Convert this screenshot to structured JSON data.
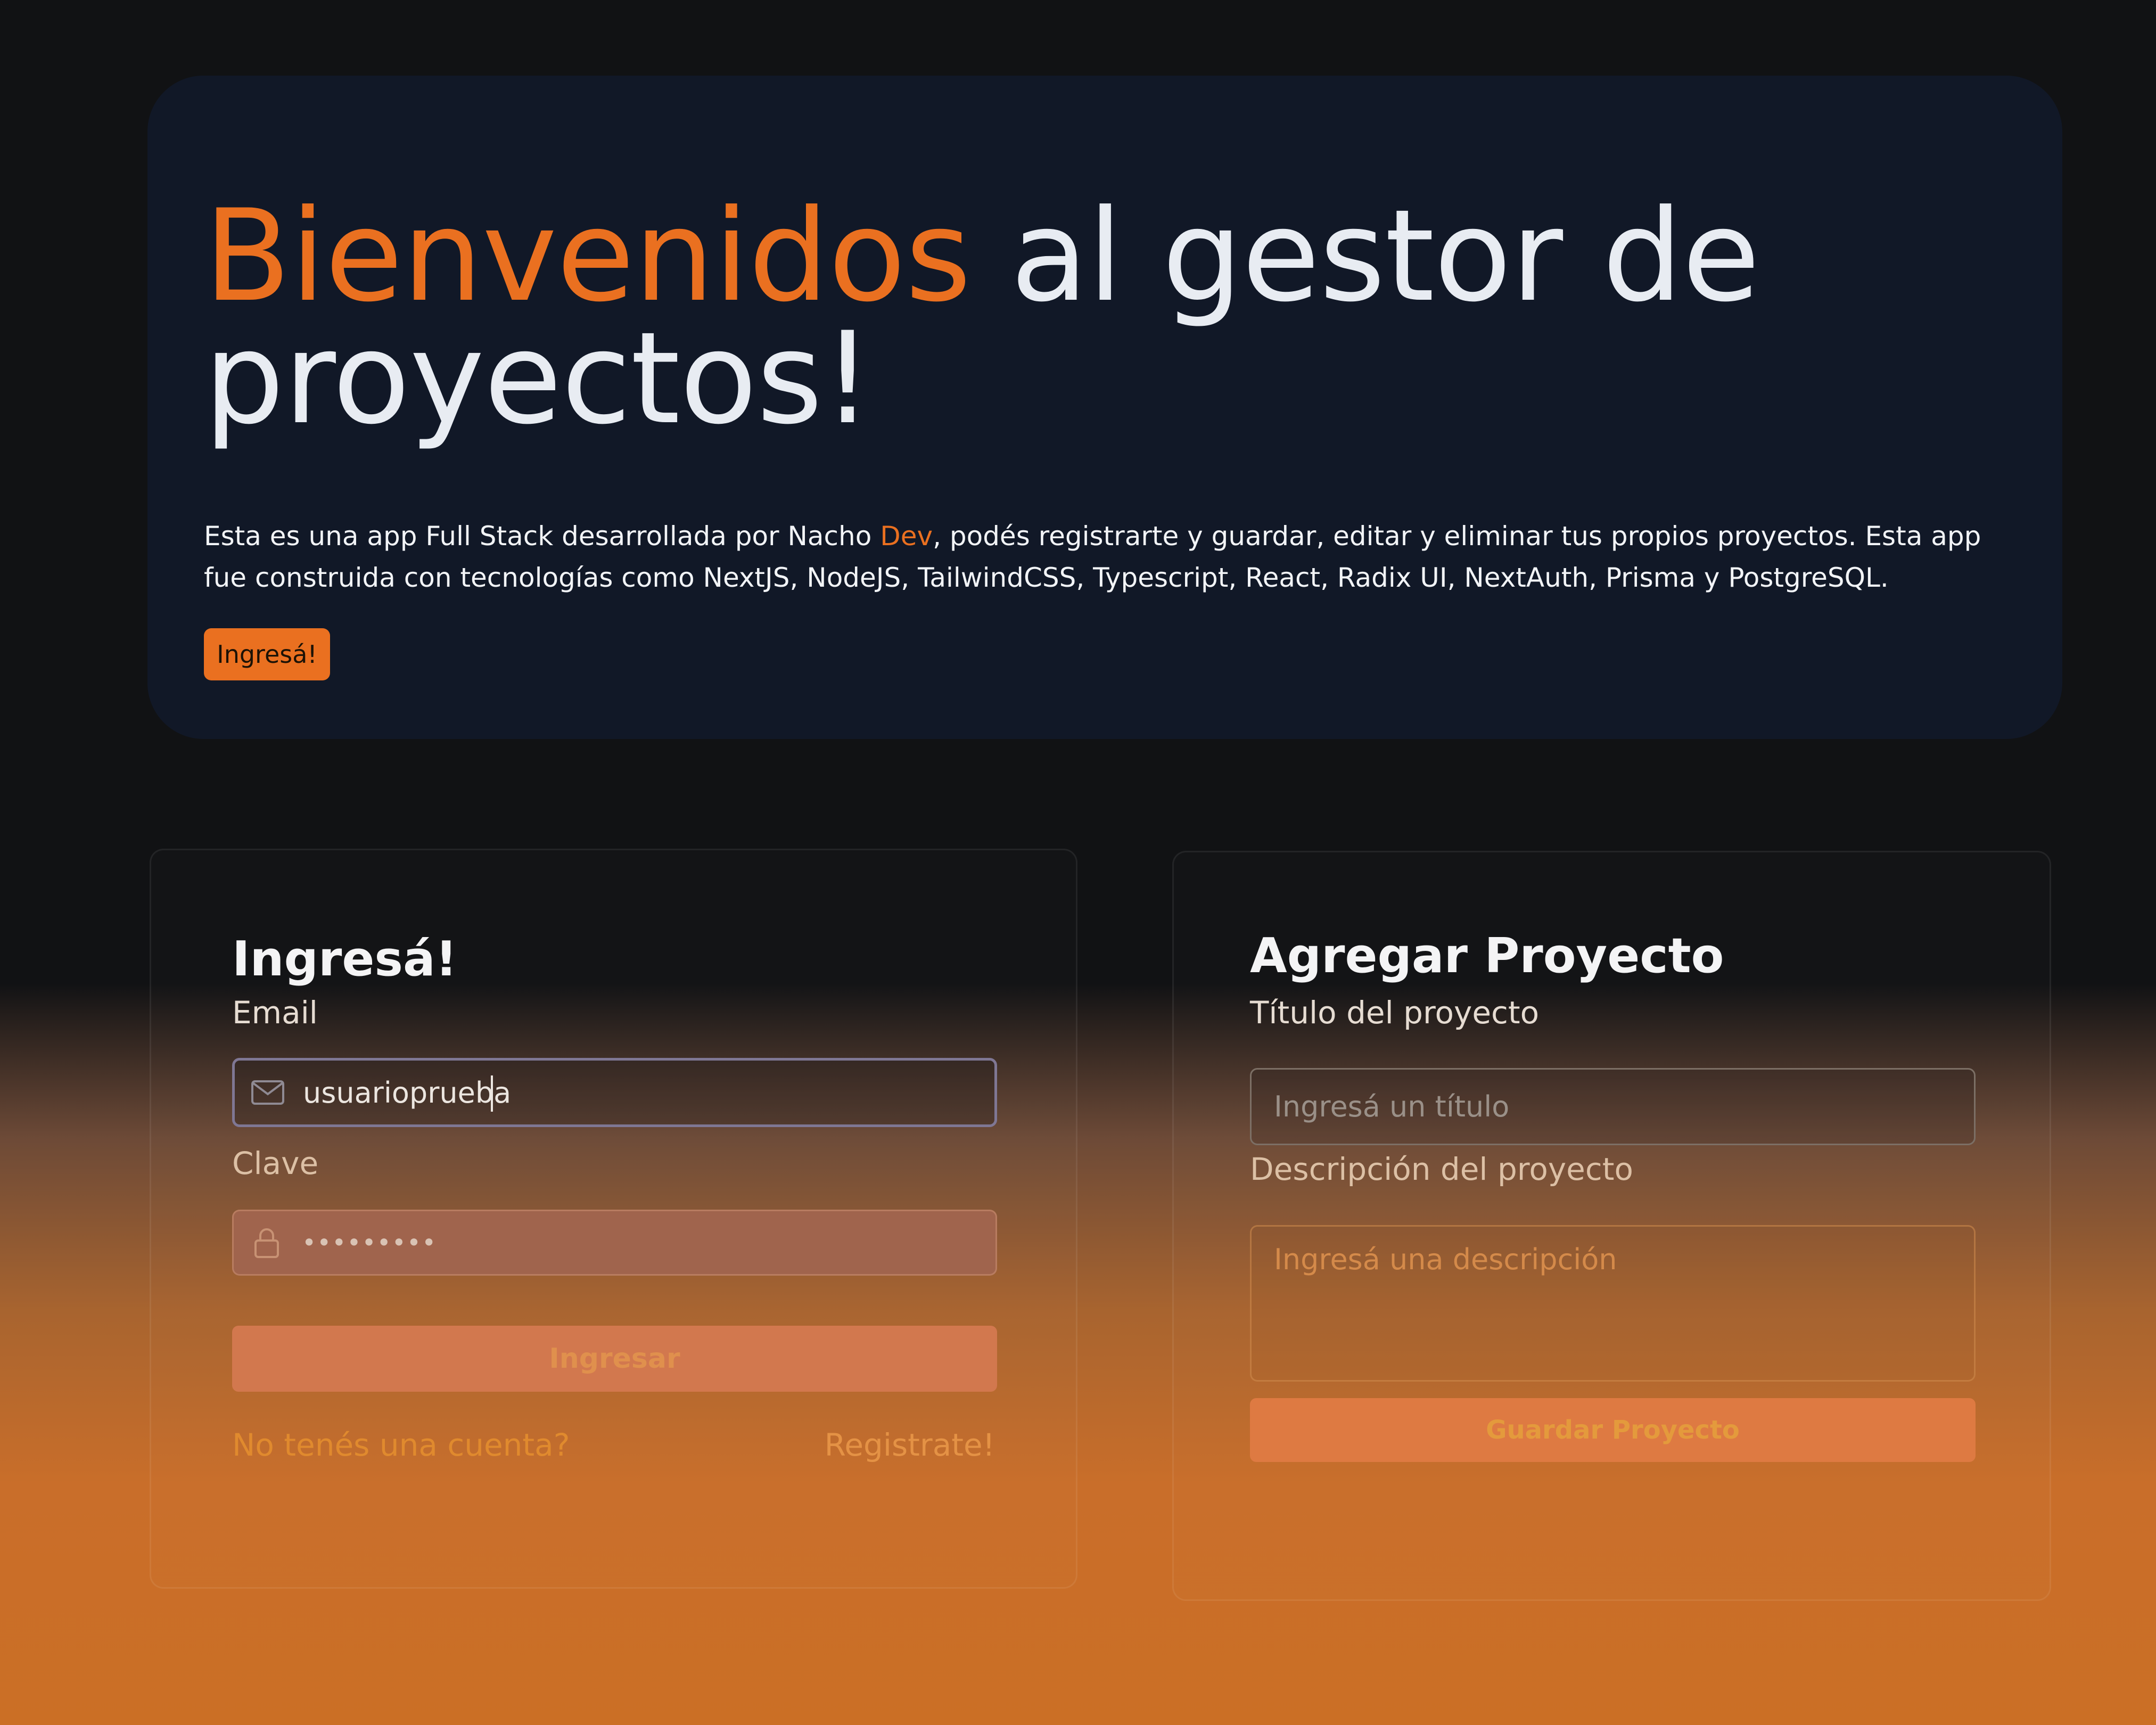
{
  "hero": {
    "title_accent": "Bienvenidos",
    "title_rest": " al gestor de proyectos!",
    "desc_before": "Esta es una app Full Stack desarrollada por Nacho ",
    "desc_accent": "Dev",
    "desc_after": ", podés registrarte y guardar, editar y eliminar tus propios proyectos. Esta app fue construida con tecnologías como NextJS, NodeJS, TailwindCSS, Typescript, React, Radix UI, NextAuth, Prisma y PostgreSQL.",
    "button_label": "Ingresá!"
  },
  "login": {
    "title": "Ingresá!",
    "email_label": "Email",
    "email_value": "usuarioprueba",
    "password_label": "Clave",
    "password_value": "•••••••••",
    "submit_label": "Ingresar",
    "no_account_text": "No tenés una cuenta?",
    "register_link": "Registrate!"
  },
  "project": {
    "title": "Agregar Proyecto",
    "title_label": "Título del proyecto",
    "title_placeholder": "Ingresá un título",
    "description_label": "Descripción del proyecto",
    "description_placeholder": "Ingresá una descripción",
    "save_label": "Guardar Proyecto"
  },
  "icons": {
    "email_field_icon": "mail-icon",
    "password_field_icon": "lock-icon"
  },
  "colors": {
    "accent": "#ea7020",
    "hero_bg": "#111827",
    "page_top": "#111214",
    "page_bottom": "#cb6f25"
  }
}
